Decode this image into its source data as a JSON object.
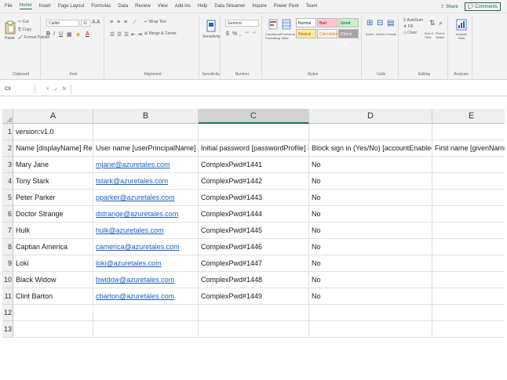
{
  "ribbon_tabs": [
    "File",
    "Home",
    "Insert",
    "Page Layout",
    "Formulas",
    "Data",
    "Review",
    "View",
    "Add-ins",
    "Help",
    "Data Streamer",
    "Inquire",
    "Power Pivot",
    "Team"
  ],
  "share_label": "Share",
  "comments_label": "Comments",
  "clipboard": {
    "paste": "Paste",
    "cut": "Cut",
    "copy": "Copy",
    "format_painter": "Format Painter",
    "label": "Clipboard"
  },
  "font": {
    "name": "Calibri",
    "size": "11",
    "label": "Font"
  },
  "alignment": {
    "wrap_text": "Wrap Text",
    "merge_center": "Merge & Center",
    "label": "Alignment"
  },
  "sensitivity": {
    "button": "Sensitivity",
    "label": "Sensitivity"
  },
  "number": {
    "format": "General",
    "label": "Number"
  },
  "styles": {
    "conditional": "Conditional Formatting",
    "format_table": "Format as Table",
    "normal": "Normal",
    "bad": "Bad",
    "good": "Good",
    "neutral": "Neutral",
    "calculation": "Calculation",
    "check_cell": "Check Cell",
    "label": "Styles"
  },
  "cells_group": {
    "insert": "Insert",
    "delete": "Delete",
    "format": "Format",
    "label": "Cells"
  },
  "editing": {
    "autosum": "AutoSum",
    "fill": "Fill",
    "clear": "Clear",
    "sort_filter": "Sort & Filter",
    "find_select": "Find & Select",
    "label": "Editing"
  },
  "analysis": {
    "analyze_data": "Analyze Data",
    "label": "Analysis"
  },
  "formula_bar": {
    "name_box": "C8",
    "cancel": "×",
    "enter": "✓",
    "fx": "fx",
    "value": ""
  },
  "columns": [
    "A",
    "B",
    "C",
    "D",
    "E"
  ],
  "selected_column": "C",
  "row_numbers": [
    "1",
    "2",
    "3",
    "4",
    "5",
    "6",
    "7",
    "8",
    "9",
    "10",
    "11",
    "12",
    "13"
  ],
  "rows": [
    [
      "version:v1.0",
      "",
      "",
      "",
      ""
    ],
    [
      "Name [displayName] Required",
      "User name [userPrincipalName] Required",
      "Initial password [passwordProfile] Required",
      "Block sign in (Yes/No) [accountEnabled] Required",
      "First name [givenName]"
    ],
    [
      "Mary Jane",
      "mjane@azuretales.com",
      "ComplexPwd#1441",
      "No",
      ""
    ],
    [
      "Tony Stark",
      "tstark@azuretales.com",
      "ComplexPwd#1442",
      "No",
      ""
    ],
    [
      "Peter Parker",
      "pparker@azuretales.com",
      "ComplexPwd#1443",
      "No",
      ""
    ],
    [
      "Doctor Strange",
      "dstrange@azuretales.com",
      "ComplexPwd#1444",
      "No",
      ""
    ],
    [
      "Hulk",
      "hulk@azuretales.com",
      "ComplexPwd#1445",
      "No",
      ""
    ],
    [
      "Captian America",
      "camerica@azuretales.com",
      "ComplexPwd#1446",
      "No",
      ""
    ],
    [
      "Loki",
      "loki@azuretales.com",
      "ComplexPwd#1447",
      "No",
      ""
    ],
    [
      "Black Widow",
      "bwidow@azuretales.com",
      "ComplexPwd#1448",
      "No",
      ""
    ],
    [
      "Clint Barton",
      "cbarton@azuretales.com",
      "ComplexPwd#1449",
      "No",
      ""
    ],
    [
      "",
      "",
      "",
      "",
      ""
    ],
    [
      "",
      "",
      "",
      "",
      ""
    ]
  ],
  "colors": {
    "accent": "#217346",
    "link": "#1f5fbf",
    "bad_fill": "#ffc7ce",
    "good_fill": "#c6efce",
    "neutral_fill": "#ffeb9c",
    "check_fill": "#a5a5a5",
    "calc_fill": "#f2f2f2"
  }
}
